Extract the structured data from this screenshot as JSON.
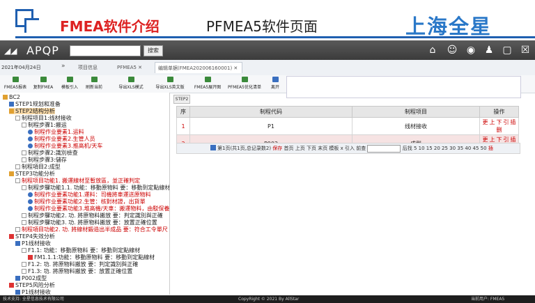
{
  "slide": {
    "title_red": "FMEA软件介绍",
    "title_black": "PFMEA5软件页面",
    "brand": "上海全星"
  },
  "app": {
    "logo": "APQP",
    "search_button": "搜索",
    "icons": [
      "home-icon",
      "users-icon",
      "globe-icon",
      "user-icon",
      "window-icon",
      "close-icon"
    ]
  },
  "tabs": {
    "date": "2021年04月24日",
    "items": [
      "项目信息",
      "PFMEA5 ✕",
      "编辑单据(FMEA202006160001) ✕"
    ]
  },
  "toolbar": {
    "buttons": [
      "FMEA5报表",
      "复制FMEA",
      "模板引入",
      "刷新当前",
      "导出XLS模式",
      "导出XLS英文版",
      "FMEA5展开图",
      "PFMEA5优化清单",
      "离开"
    ]
  },
  "tree": [
    {
      "text": "BC2",
      "indent": 0,
      "mark": "folder"
    },
    {
      "text": "STEP1规划和准备",
      "indent": 1,
      "mark": "blue"
    },
    {
      "text": "STEP2结构分析",
      "indent": 1,
      "mark": "folder",
      "selected": true
    },
    {
      "text": "制程项目1:线材接收",
      "indent": 2,
      "mark": "exp"
    },
    {
      "text": "制程步骤1:搬运",
      "indent": 3,
      "mark": "exp"
    },
    {
      "text": "制程作业要素1.运料",
      "indent": 4,
      "mark": "person",
      "color": "red"
    },
    {
      "text": "制程作业要素2.生管人员",
      "indent": 4,
      "mark": "person",
      "color": "red"
    },
    {
      "text": "制程作业要素3.推高机/天车",
      "indent": 4,
      "mark": "person",
      "color": "red"
    },
    {
      "text": "制程步骤2:識別檢查",
      "indent": 3,
      "mark": "exp"
    },
    {
      "text": "制程步骤3:儲存",
      "indent": 3,
      "mark": "exp"
    },
    {
      "text": "制程項目2:成型",
      "indent": 2,
      "mark": "exp"
    },
    {
      "text": "STEP3功能分析",
      "indent": 1,
      "mark": "folder"
    },
    {
      "text": "制程项目功能1. 搬運線材至暫放區，並正確判定",
      "indent": 2,
      "mark": "exp",
      "color": "red"
    },
    {
      "text": "制程步驟功能1.1. 功能：移動原物料 要：移動到定點線材",
      "indent": 3,
      "mark": "exp"
    },
    {
      "text": "制程作业要素功能1.運料：司機將車運送原物料",
      "indent": 4,
      "mark": "person",
      "color": "red"
    },
    {
      "text": "制程作业要素功能2.生管：核對材證，出貨單",
      "indent": 4,
      "mark": "person",
      "color": "red"
    },
    {
      "text": "制程作业要素功能3.堆高機/天車：搬運物料，由駁保養",
      "indent": 4,
      "mark": "person",
      "color": "red"
    },
    {
      "text": "制程步驟功能2. 功. 將原物料搬放 要：判定識別與正確",
      "indent": 3,
      "mark": "exp"
    },
    {
      "text": "制程步驟功能3. 功. 將原物料搬放 要：放置正確位置",
      "indent": 3,
      "mark": "exp"
    },
    {
      "text": "制程項目功能2. 功. 將線材鍛造出半成品 要：符合工令單尺",
      "indent": 2,
      "mark": "exp",
      "color": "red"
    },
    {
      "text": "STEP4失效分析",
      "indent": 1,
      "mark": "red"
    },
    {
      "text": "P1线材接收",
      "indent": 2,
      "mark": "blue"
    },
    {
      "text": "F1.1: 功能：移動原物料 要：移動到定點線材",
      "indent": 3,
      "mark": "exp"
    },
    {
      "text": "FM1.1.1:功能：移動原物料 要：移動到定點線材",
      "indent": 4,
      "mark": "red"
    },
    {
      "text": "F1.2: 功. 將原物料搬放 要：判定識別與正確",
      "indent": 3,
      "mark": "exp"
    },
    {
      "text": "F1.3: 功. 將原物料搬放 要：放置正確位置",
      "indent": 3,
      "mark": "exp"
    },
    {
      "text": "P002成型",
      "indent": 2,
      "mark": "blue"
    },
    {
      "text": "STEP5风险分析",
      "indent": 1,
      "mark": "red"
    },
    {
      "text": "P1线材接收",
      "indent": 2,
      "mark": "blue"
    }
  ],
  "breadcrumb": "STEP2",
  "grid": {
    "headers": [
      "序",
      "制程代码",
      "制程项目",
      "操作"
    ],
    "rows": [
      {
        "num": "1",
        "code": "P1",
        "item": "线材接收",
        "ops": [
          "更",
          "上",
          "下",
          "引",
          "插",
          "删"
        ]
      },
      {
        "num": "2",
        "code": "P002",
        "item": "成型",
        "ops": [
          "更",
          "上",
          "下",
          "引",
          "插",
          "删"
        ]
      }
    ]
  },
  "pager": {
    "text_a": "第1页(共1页,总记录数2)",
    "save": "保存",
    "text_b": "首页 上页 下页 末页 模板 x 引入 前查",
    "text_c": "后找 5 10 15 20 25 30 35 40 45 50",
    "insert": "插"
  },
  "footer": {
    "left": "技术支持: 全星信息技术有限公司",
    "center": "CopyRight © 2021 By AllStar",
    "right": "当前用户: FMEA5"
  }
}
